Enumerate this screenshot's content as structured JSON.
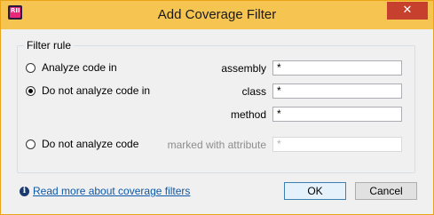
{
  "window": {
    "title": "Add Coverage Filter",
    "close_glyph": "✕",
    "app_icon_text": "RII"
  },
  "filter_rule": {
    "group_label": "Filter rule",
    "options": [
      {
        "label": "Analyze code in",
        "checked": false
      },
      {
        "label": "Do not analyze code in",
        "checked": true
      },
      {
        "label": "Do not analyze code",
        "checked": false
      }
    ],
    "fields": [
      {
        "label": "assembly",
        "value": "*",
        "enabled": true
      },
      {
        "label": "class",
        "value": "*",
        "enabled": true
      },
      {
        "label": "method",
        "value": "*",
        "enabled": true
      },
      {
        "label": "marked with attribute",
        "value": "*",
        "enabled": false
      }
    ]
  },
  "footer": {
    "info_glyph": "i",
    "link_text": "Read more about coverage filters",
    "ok_label": "OK",
    "cancel_label": "Cancel"
  },
  "colors": {
    "titlebar": "#f6c451",
    "close": "#c7402d",
    "link": "#0d58a8"
  }
}
